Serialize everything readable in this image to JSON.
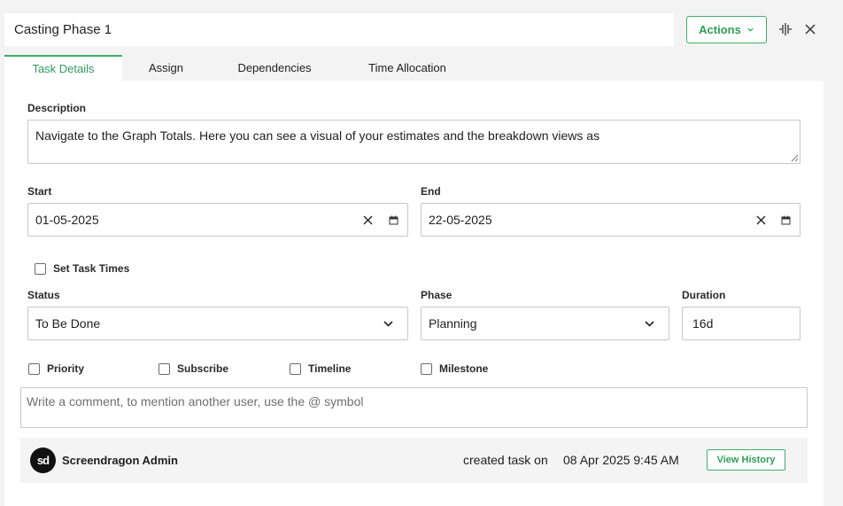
{
  "header": {
    "title": "Casting Phase 1",
    "actions_label": "Actions"
  },
  "tabs": [
    {
      "label": "Task Details",
      "active": true
    },
    {
      "label": "Assign"
    },
    {
      "label": "Dependencies"
    },
    {
      "label": "Time Allocation"
    }
  ],
  "form": {
    "description_label": "Description",
    "description_value": "Navigate to the Graph Totals. Here you can see a visual of your estimates and the breakdown views as",
    "start_label": "Start",
    "start_value": "01-05-2025",
    "end_label": "End",
    "end_value": "22-05-2025",
    "set_task_times_label": "Set Task Times",
    "status_label": "Status",
    "status_value": "To Be Done",
    "phase_label": "Phase",
    "phase_value": "Planning",
    "duration_label": "Duration",
    "duration_value": "16d",
    "checkboxes": {
      "priority": "Priority",
      "subscribe": "Subscribe",
      "timeline": "Timeline",
      "milestone": "Milestone"
    },
    "comment_placeholder": "Write a comment, to mention another user, use the @ symbol"
  },
  "history": {
    "avatar_initials": "sd",
    "user_name": "Screendragon Admin",
    "action_text": "created task on",
    "date_text": "08 Apr 2025 9:45 AM",
    "view_history_label": "View History"
  },
  "colors": {
    "accent": "#2f9d57",
    "accent_border": "#3fae6a",
    "background": "#f3f3f3"
  }
}
